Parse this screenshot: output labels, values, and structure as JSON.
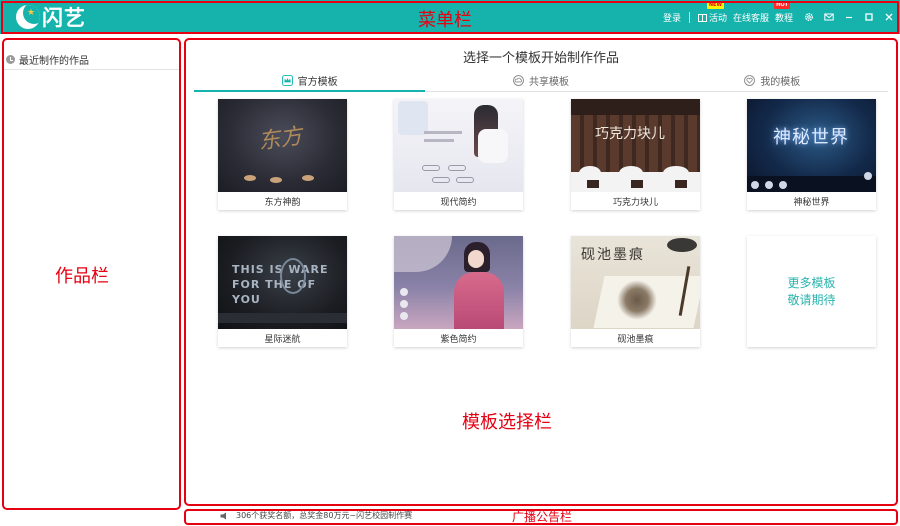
{
  "app": {
    "logo_text": "闪艺"
  },
  "menu": {
    "login": "登录",
    "activity": "活动",
    "activity_tag": "NEW",
    "support": "在线客服",
    "tutorial": "教程",
    "tutorial_tag": "HOT",
    "icons": [
      "gift-icon",
      "gear-icon",
      "mail-icon",
      "minimize-icon",
      "maximize-icon",
      "close-icon"
    ]
  },
  "works": {
    "title": "最近制作的作品"
  },
  "templates": {
    "title": "选择一个模板开始制作作品",
    "tabs": [
      {
        "label": "官方模板",
        "icon": "crown-icon",
        "active": true
      },
      {
        "label": "共享模板",
        "icon": "cloud-icon",
        "active": false
      },
      {
        "label": "我的模板",
        "icon": "heart-icon",
        "active": false
      }
    ],
    "cards": [
      {
        "name": "东方神韵",
        "thumb_text": "东方"
      },
      {
        "name": "现代简约",
        "thumb_text": ""
      },
      {
        "name": "巧克力块儿",
        "thumb_text": "巧克力块儿"
      },
      {
        "name": "神秘世界",
        "thumb_text": "神秘世界"
      },
      {
        "name": "星际迷航",
        "thumb_text": "THIS IS WARE FOR THE OF YOU"
      },
      {
        "name": "紫色简约",
        "thumb_text": ""
      },
      {
        "name": "砚池墨痕",
        "thumb_text": "砚池墨痕"
      }
    ],
    "more_line1": "更多模板",
    "more_line2": "敬请期待"
  },
  "ad": {
    "text": "306个获奖名额，总奖金80万元~闪艺校园制作赛"
  },
  "annotations": {
    "menu_bar": "菜单栏",
    "works_bar": "作品栏",
    "template_bar": "模板选择栏",
    "ad_bar": "广播公告栏"
  },
  "colors": {
    "accent": "#15b3ac",
    "annotation": "#e60012",
    "more_text": "#2bb3ad"
  }
}
